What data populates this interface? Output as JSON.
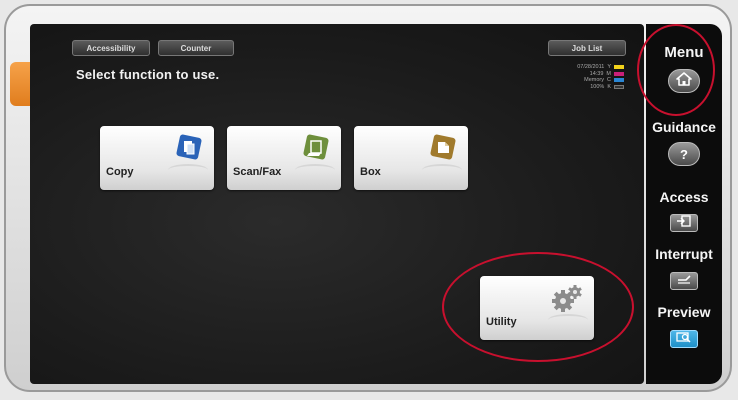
{
  "top_tabs": {
    "accessibility": "Accessibility",
    "counter": "Counter",
    "job_list": "Job List"
  },
  "title": "Select function to use.",
  "status": {
    "date": "07/28/2011",
    "time": "14:39",
    "memory_label": "Memory",
    "memory_value": "100%",
    "toner": [
      {
        "letter": "Y",
        "color": "#f2d21b"
      },
      {
        "letter": "M",
        "color": "#c8207a"
      },
      {
        "letter": "C",
        "color": "#2a86d4"
      },
      {
        "letter": "K",
        "color": "#333333"
      }
    ]
  },
  "functions": {
    "copy": "Copy",
    "scan_fax": "Scan/Fax",
    "box": "Box",
    "utility": "Utility"
  },
  "panel": {
    "menu": "Menu",
    "guidance": "Guidance",
    "guidance_symbol": "?",
    "access": "Access",
    "interrupt": "Interrupt",
    "preview": "Preview"
  },
  "colors": {
    "highlight_circle": "#c8102e",
    "copy_icon": "#2a63b8",
    "scan_icon": "#6e8f3c",
    "box_icon": "#a07a2c",
    "preview_button": "#1e90c8"
  }
}
